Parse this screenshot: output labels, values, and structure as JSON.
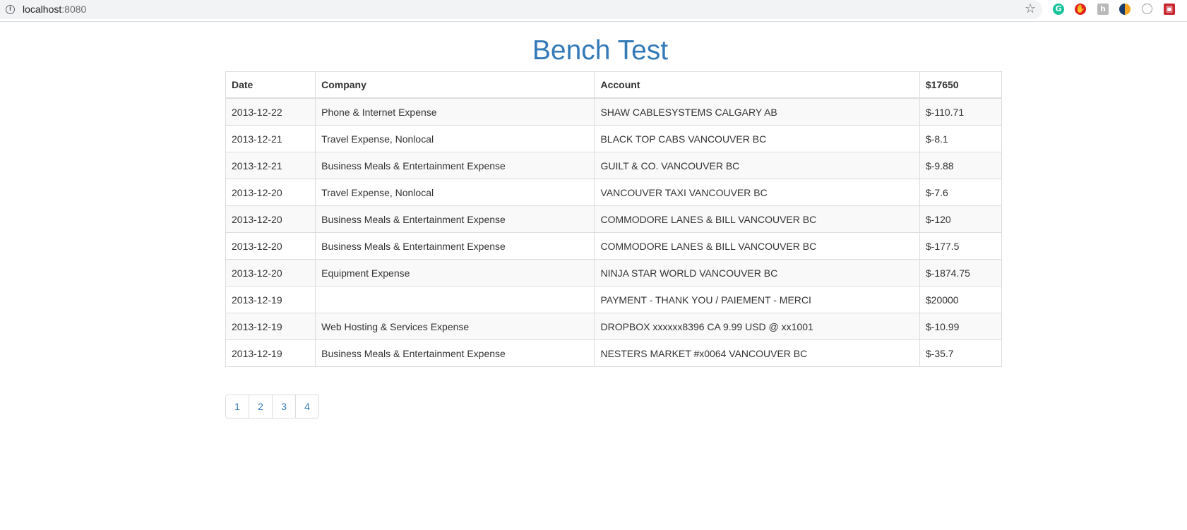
{
  "browser": {
    "url_host": "localhost",
    "url_port": ":8080",
    "extensions": [
      "grammarly-icon",
      "adblock-icon",
      "extension-icon",
      "half-moon-icon",
      "globe-icon",
      "puzzle-icon"
    ]
  },
  "page": {
    "title": "Bench Test"
  },
  "table": {
    "headers": [
      "Date",
      "Company",
      "Account",
      "$17650"
    ],
    "rows": [
      [
        "2013-12-22",
        "Phone & Internet Expense",
        "SHAW CABLESYSTEMS CALGARY AB",
        "$-110.71"
      ],
      [
        "2013-12-21",
        "Travel Expense, Nonlocal",
        "BLACK TOP CABS VANCOUVER BC",
        "$-8.1"
      ],
      [
        "2013-12-21",
        "Business Meals & Entertainment Expense",
        "GUILT & CO. VANCOUVER BC",
        "$-9.88"
      ],
      [
        "2013-12-20",
        "Travel Expense, Nonlocal",
        "VANCOUVER TAXI VANCOUVER BC",
        "$-7.6"
      ],
      [
        "2013-12-20",
        "Business Meals & Entertainment Expense",
        "COMMODORE LANES & BILL VANCOUVER BC",
        "$-120"
      ],
      [
        "2013-12-20",
        "Business Meals & Entertainment Expense",
        "COMMODORE LANES & BILL VANCOUVER BC",
        "$-177.5"
      ],
      [
        "2013-12-20",
        "Equipment Expense",
        "NINJA STAR WORLD VANCOUVER BC",
        "$-1874.75"
      ],
      [
        "2013-12-19",
        "",
        "PAYMENT - THANK YOU / PAIEMENT - MERCI",
        "$20000"
      ],
      [
        "2013-12-19",
        "Web Hosting & Services Expense",
        "DROPBOX xxxxxx8396 CA 9.99 USD @ xx1001",
        "$-10.99"
      ],
      [
        "2013-12-19",
        "Business Meals & Entertainment Expense",
        "NESTERS MARKET #x0064 VANCOUVER BC",
        "$-35.7"
      ]
    ]
  },
  "pagination": {
    "pages": [
      "1",
      "2",
      "3",
      "4"
    ]
  },
  "colors": {
    "link": "#337ab7",
    "border": "#dddddd",
    "row_stripe": "#f9f9f9"
  }
}
